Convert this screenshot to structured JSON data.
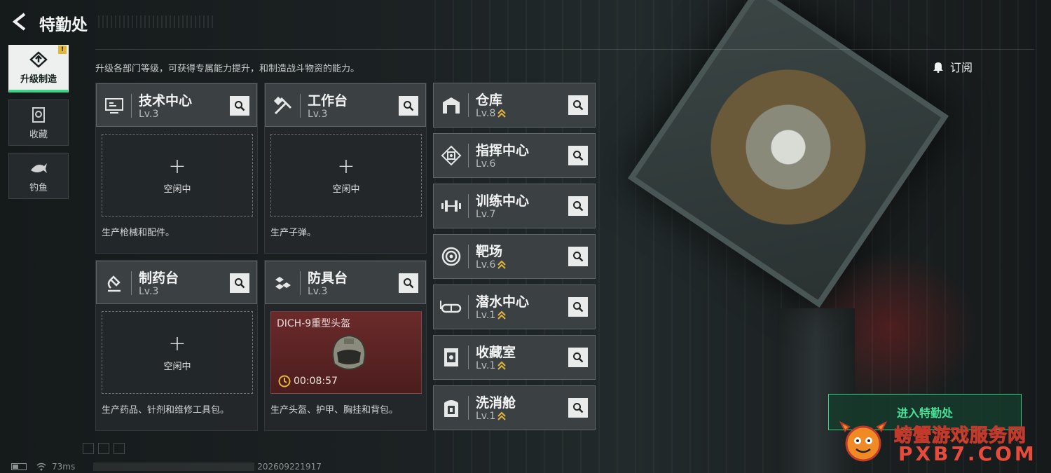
{
  "header": {
    "title": "特勤处",
    "description": "升级各部门等级，可获得专属能力提升，和制造战斗物资的能力。"
  },
  "nav": {
    "items": [
      {
        "label": "升级制造",
        "icon": "upgrade-icon",
        "active": true,
        "badge": "!"
      },
      {
        "label": "收藏",
        "icon": "collection-icon",
        "active": false
      },
      {
        "label": "钓鱼",
        "icon": "fish-icon",
        "active": false
      }
    ]
  },
  "production": [
    {
      "name": "技术中心",
      "level": "Lv.3",
      "icon": "tech-center-icon",
      "slot_status": "空闲中",
      "slot_plus": "+",
      "description": "生产枪械和配件。"
    },
    {
      "name": "工作台",
      "level": "Lv.3",
      "icon": "workbench-icon",
      "slot_status": "空闲中",
      "slot_plus": "+",
      "description": "生产子弹。"
    },
    {
      "name": "制药台",
      "level": "Lv.3",
      "icon": "pharmacy-icon",
      "slot_status": "空闲中",
      "slot_plus": "+",
      "description": "生产药品、针剂和维修工具包。"
    },
    {
      "name": "防具台",
      "level": "Lv.3",
      "icon": "armor-bench-icon",
      "crafting_item": "DICH-9重型头盔",
      "timer": "00:08:57",
      "description": "生产头盔、护甲、胸挂和背包。"
    }
  ],
  "buildings": [
    {
      "name": "仓库",
      "level": "Lv.8",
      "icon": "warehouse-icon",
      "upgradable": true
    },
    {
      "name": "指挥中心",
      "level": "Lv.6",
      "icon": "command-center-icon",
      "upgradable": false
    },
    {
      "name": "训练中心",
      "level": "Lv.7",
      "icon": "training-center-icon",
      "upgradable": false
    },
    {
      "name": "靶场",
      "level": "Lv.6",
      "icon": "shooting-range-icon",
      "upgradable": true
    },
    {
      "name": "潜水中心",
      "level": "Lv.1",
      "icon": "diving-center-icon",
      "upgradable": true
    },
    {
      "name": "收藏室",
      "level": "Lv.1",
      "icon": "collection-room-icon",
      "upgradable": true
    },
    {
      "name": "洗消舱",
      "level": "Lv.1",
      "icon": "decon-chamber-icon",
      "upgradable": true
    }
  ],
  "right_panel": {
    "subscribe_label": "订阅",
    "enter_label": "进入特勤处"
  },
  "watermark": {
    "text": "螃蟹游戏服务网",
    "url": "PXB7.COM"
  },
  "status": {
    "ping": "73ms",
    "uid": "202609221917"
  },
  "colors": {
    "accent": "#3fd38a",
    "upgrade_arrow": "#e3b63a",
    "craft_bg": "#6b2a2a"
  }
}
